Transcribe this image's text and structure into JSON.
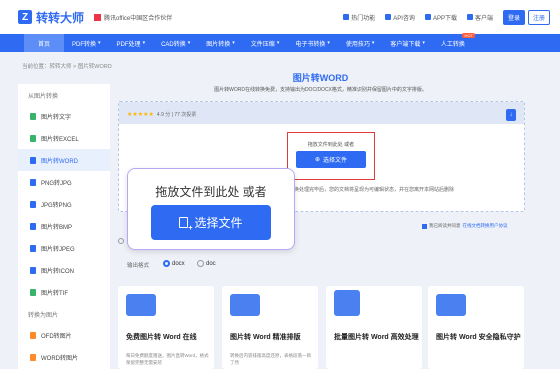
{
  "header": {
    "logo_text": "转转大师",
    "partner_text": "腾讯office中国区合作伙伴",
    "links": [
      {
        "label": "热门功能",
        "icon": "home-icon"
      },
      {
        "label": "API咨询",
        "icon": "api-icon"
      },
      {
        "label": "APP下载",
        "icon": "phone-icon"
      },
      {
        "label": "客户端",
        "icon": "download-icon"
      }
    ],
    "login_label": "登录",
    "register_label": "注册"
  },
  "nav": {
    "items": [
      {
        "label": "首页",
        "caret": false
      },
      {
        "label": "PDF转换",
        "caret": true
      },
      {
        "label": "PDF处理",
        "caret": true
      },
      {
        "label": "CAD转换",
        "caret": true
      },
      {
        "label": "图片转换",
        "caret": true
      },
      {
        "label": "文件压缩",
        "caret": true
      },
      {
        "label": "电子书转换",
        "caret": true
      },
      {
        "label": "使用技巧",
        "caret": true
      },
      {
        "label": "客户端下载",
        "caret": true
      },
      {
        "label": "人工转换",
        "caret": false,
        "badge": "HOT"
      }
    ]
  },
  "breadcrumb": "当前位置：转转大师 > 图片转WORD",
  "sidebar": {
    "section1": "从图片转换",
    "items1": [
      {
        "label": "图片转文字",
        "color": "#38b36a"
      },
      {
        "label": "图片转EXCEL",
        "color": "#38b36a"
      },
      {
        "label": "图片转WORD",
        "color": "#2f6bf2"
      },
      {
        "label": "PNG转JPG",
        "color": "#2f6bf2"
      },
      {
        "label": "JPG转PNG",
        "color": "#2f6bf2"
      },
      {
        "label": "图片转BMP",
        "color": "#2f6bf2"
      },
      {
        "label": "图片转JPEG",
        "color": "#2f6bf2"
      },
      {
        "label": "图片转ICON",
        "color": "#2f6bf2"
      },
      {
        "label": "图片转TIF",
        "color": "#38b36a"
      }
    ],
    "section2": "转换为图片",
    "items2": [
      {
        "label": "OFD转图片",
        "color": "#ff8a2a"
      },
      {
        "label": "WORD转图片",
        "color": "#ff8a2a"
      }
    ]
  },
  "main": {
    "title": "图片转WORD",
    "subtitle": "图片转WORD在线转换免费，支持输出为DOC/DOCX格式，精准识别并保留图片中的文字排版。",
    "rating_stars": "★★★★★",
    "rating_text": "4.9 分 | 77 次投票",
    "drop_hint": "拖放文件到此处 或者",
    "select_button": "选择文件",
    "privacy_text": "图片转换处理完毕后，您的文档将呈现为可编辑状态，并在您离开本网站后删除",
    "agree_text": "我已阅读并同意",
    "agree_link": "在线文档转换用户协议",
    "format_label": "输出格式",
    "formats": [
      {
        "label": "docx",
        "selected": true
      },
      {
        "label": "doc",
        "selected": false
      }
    ]
  },
  "cards": [
    {
      "title": "免费图片转 Word 在线",
      "desc": "每日免费额度赠送，图片直转Word，格式保留完整无需安装"
    },
    {
      "title": "图片转 Word 精准排版",
      "desc": "转换后内容排版高度还原，表格段落一目了然"
    },
    {
      "title": "批量图片转 Word 高效处理",
      "desc": ""
    },
    {
      "title": "图片转 Word 安全隐私守护",
      "desc": ""
    }
  ],
  "zoom_overlay": {
    "hint": "拖放文件到此处 或者",
    "button": "选择文件"
  },
  "colors": {
    "brand": "#2f6bf2",
    "highlight_box": "#e03b3b",
    "overlay_border": "#b9a7f5"
  }
}
